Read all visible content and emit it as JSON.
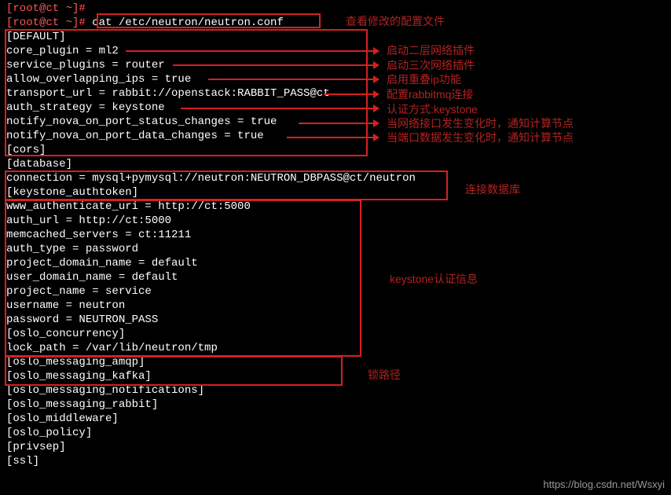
{
  "prompt1": "[root@ct ~]#",
  "prompt2": "[root@ct ~]# ",
  "cmd": "cat /etc/neutron/neutron.conf",
  "cfg": {
    "s_default": "[DEFAULT]",
    "core_plugin": "core_plugin = ml2",
    "service_plugins": "service_plugins = router",
    "allow_overlap": "allow_overlapping_ips = true",
    "transport": "transport_url = rabbit://openstack:RABBIT_PASS@ct",
    "auth_strategy": "auth_strategy = keystone",
    "notify_status": "notify_nova_on_port_status_changes = true",
    "notify_data": "notify_nova_on_port_data_changes = true",
    "s_cors": "[cors]",
    "s_database": "[database]",
    "db_conn": "connection = mysql+pymysql://neutron:NEUTRON_DBPASS@ct/neutron",
    "s_keystone": "[keystone_authtoken]",
    "www_auth": "www_authenticate_uri = http://ct:5000",
    "auth_url": "auth_url = http://ct:5000",
    "memcached": "memcached_servers = ct:11211",
    "auth_type": "auth_type = password",
    "proj_domain": "project_domain_name = default",
    "user_domain": "user_domain_name = default",
    "proj_name": "project_name = service",
    "username": "username = neutron",
    "password": "password = NEUTRON_PASS",
    "s_oslo_conc": "[oslo_concurrency]",
    "lock_path": "lock_path = /var/lib/neutron/tmp",
    "s_amqp": "[oslo_messaging_amqp]",
    "s_kafka": "[oslo_messaging_kafka]",
    "s_notif": "[oslo_messaging_notifications]",
    "s_rabbit": "[oslo_messaging_rabbit]",
    "s_middleware": "[oslo_middleware]",
    "s_policy": "[oslo_policy]",
    "s_privsep": "[privsep]",
    "s_ssl": "[ssl]"
  },
  "ann": {
    "view_conf": "查看修改的配置文件",
    "l2_plugin": "启动二层网络插件",
    "l3_plugin": "启动三次网络插件",
    "overlap_ip": "启用重叠ip功能",
    "rabbit": "配置rabbitmq连接",
    "keystone_auth": "认证方式:keystone",
    "port_status": "当网络接口发生变化时，通知计算节点",
    "port_data": "当端口数据发生变化时，通知计算节点",
    "db": "连接数据库",
    "ks_info": "keystone认证信息",
    "lock": "锁路径"
  },
  "watermark": "https://blog.csdn.net/Wsxyi"
}
